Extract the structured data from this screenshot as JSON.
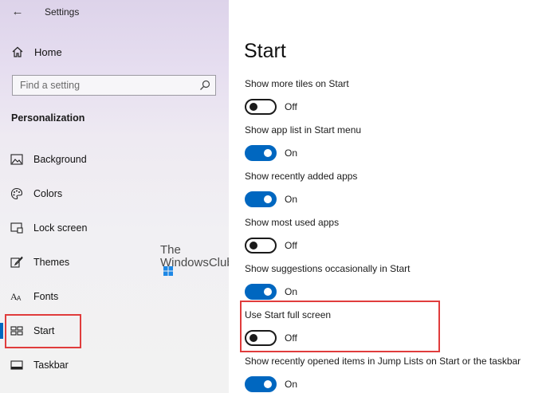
{
  "window": {
    "title": "Settings"
  },
  "sidebar": {
    "home_label": "Home",
    "search": {
      "placeholder": "Find a setting",
      "value": ""
    },
    "section_title": "Personalization",
    "items": [
      {
        "label": "Background",
        "icon": "picture-icon"
      },
      {
        "label": "Colors",
        "icon": "palette-icon"
      },
      {
        "label": "Lock screen",
        "icon": "lock-screen-icon"
      },
      {
        "label": "Themes",
        "icon": "themes-brush-icon"
      },
      {
        "label": "Fonts",
        "icon": "fonts-icon"
      },
      {
        "label": "Start",
        "icon": "start-tiles-icon",
        "selected": true
      },
      {
        "label": "Taskbar",
        "icon": "taskbar-icon"
      }
    ]
  },
  "watermark": {
    "line1": "The",
    "line2": "WindowsClub"
  },
  "main": {
    "title": "Start",
    "settings": [
      {
        "label": "Show more tiles on Start",
        "state": "Off",
        "on": false
      },
      {
        "label": "Show app list in Start menu",
        "state": "On",
        "on": true
      },
      {
        "label": "Show recently added apps",
        "state": "On",
        "on": true
      },
      {
        "label": "Show most used apps",
        "state": "Off",
        "on": false
      },
      {
        "label": "Show suggestions occasionally in Start",
        "state": "On",
        "on": true
      },
      {
        "label": "Use Start full screen",
        "state": "Off",
        "on": false
      },
      {
        "label": "Show recently opened items in Jump Lists on Start or the taskbar",
        "state": "On",
        "on": true
      }
    ]
  },
  "colors": {
    "accent": "#0067c0",
    "highlight": "#e03c3c"
  }
}
